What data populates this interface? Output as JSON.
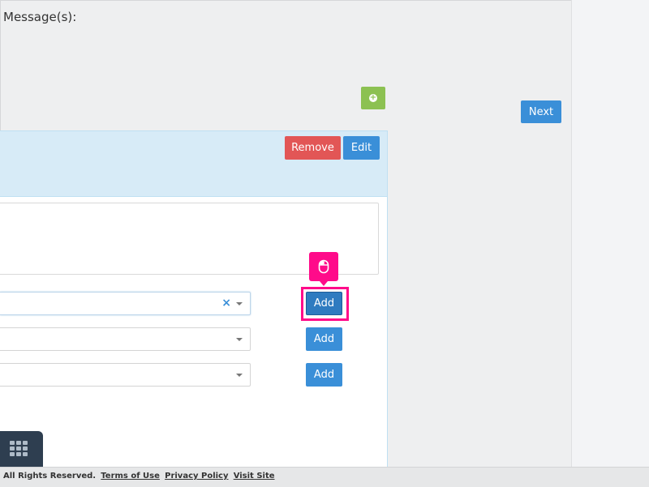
{
  "messages": {
    "label": "Message(s):"
  },
  "nav": {
    "next_label": "Next"
  },
  "card": {
    "remove_label": "Remove",
    "edit_label": "Edit"
  },
  "rows": [
    {
      "add_label": "Add",
      "selected": true
    },
    {
      "add_label": "Add",
      "selected": false
    },
    {
      "add_label": "Add",
      "selected": false
    }
  ],
  "footer": {
    "copyright": "All Rights Reserved.",
    "links": [
      "Terms of Use",
      "Privacy Policy",
      "Visit Site"
    ]
  },
  "colors": {
    "primary": "#3a8fd8",
    "danger": "#e25656",
    "success": "#8cc152",
    "highlight": "#ff0b8a",
    "dock": "#2e3e50"
  },
  "icons": {
    "add_message": "plus-circle-icon",
    "clear": "close-icon",
    "dropdown": "chevron-down-icon",
    "dock": "grid-icon",
    "cursor": "mouse-icon"
  }
}
